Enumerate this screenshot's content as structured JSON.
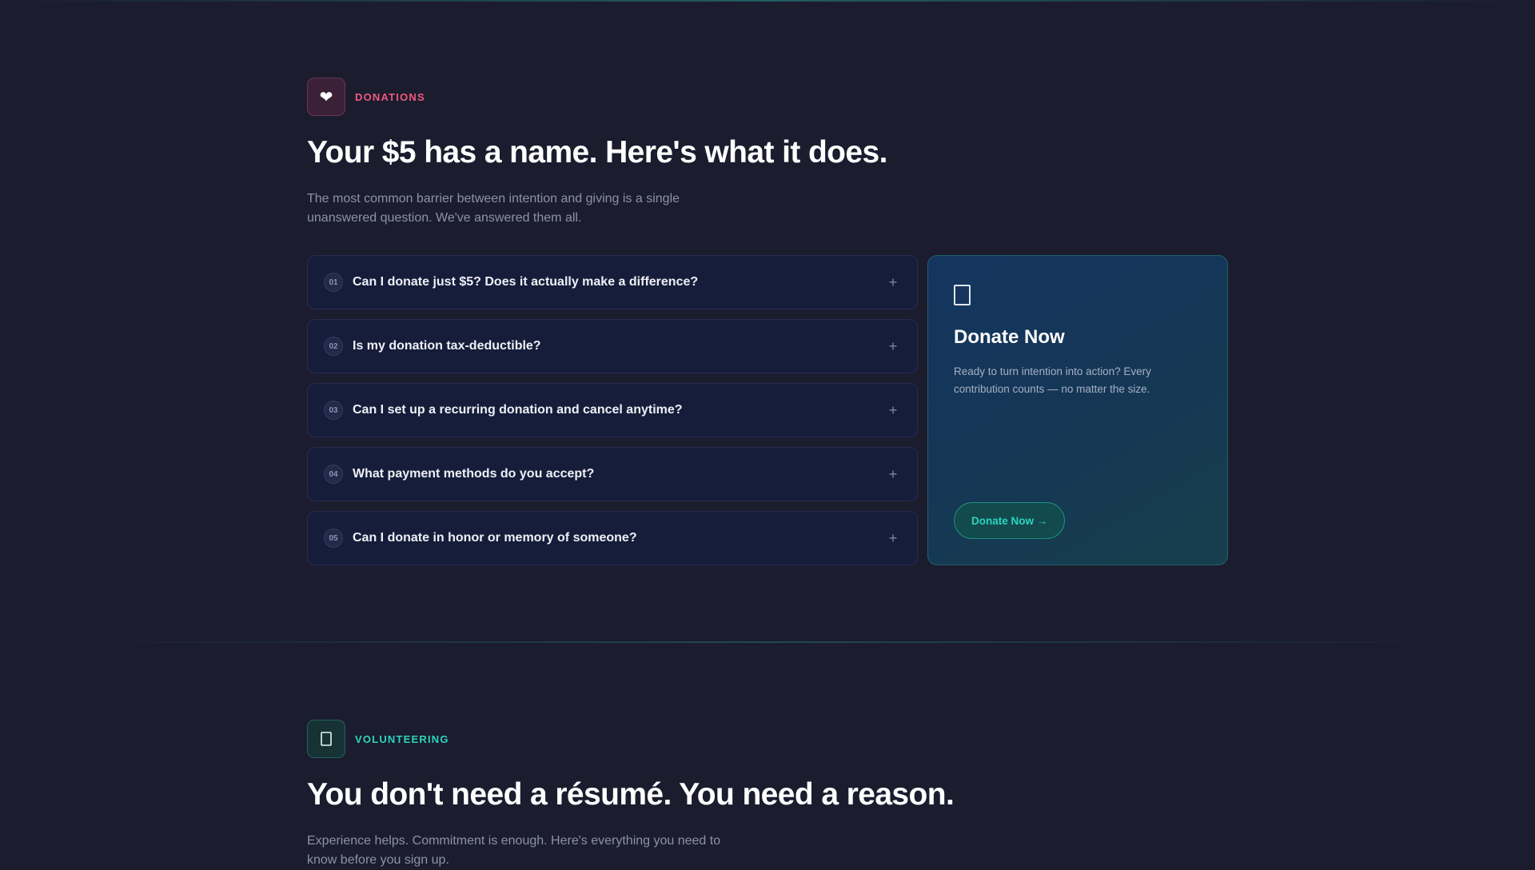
{
  "donations": {
    "eyebrow_icon": "heart-icon",
    "eyebrow_icon_glyph": "❤",
    "eyebrow": "DONATIONS",
    "heading": "Your $5 has a name. Here's what it does.",
    "lead": "The most common barrier between intention and giving is a single unanswered question. We've answered them all.",
    "accent_color": "#f0587f",
    "faq": [
      {
        "num": "01",
        "question": "Can I donate just $5? Does it actually make a difference?",
        "toggle": "+"
      },
      {
        "num": "02",
        "question": "Is my donation tax-deductible?",
        "toggle": "+"
      },
      {
        "num": "03",
        "question": "Can I set up a recurring donation and cancel anytime?",
        "toggle": "+"
      },
      {
        "num": "04",
        "question": "What payment methods do you accept?",
        "toggle": "+"
      },
      {
        "num": "05",
        "question": "Can I donate in honor or memory of someone?",
        "toggle": "+"
      }
    ],
    "cta": {
      "icon": "document-icon",
      "title": "Donate Now",
      "text": "Ready to turn intention into action? Every contribution counts — no matter the size.",
      "button_label": "Donate Now →",
      "accent_color": "#2dd4bf"
    }
  },
  "volunteering": {
    "eyebrow_icon": "document-icon",
    "eyebrow": "VOLUNTEERING",
    "heading": "You don't need a résumé. You need a reason.",
    "lead": "Experience helps. Commitment is enough. Here's everything you need to know before you sign up.",
    "accent_color": "#2dd4bf"
  }
}
